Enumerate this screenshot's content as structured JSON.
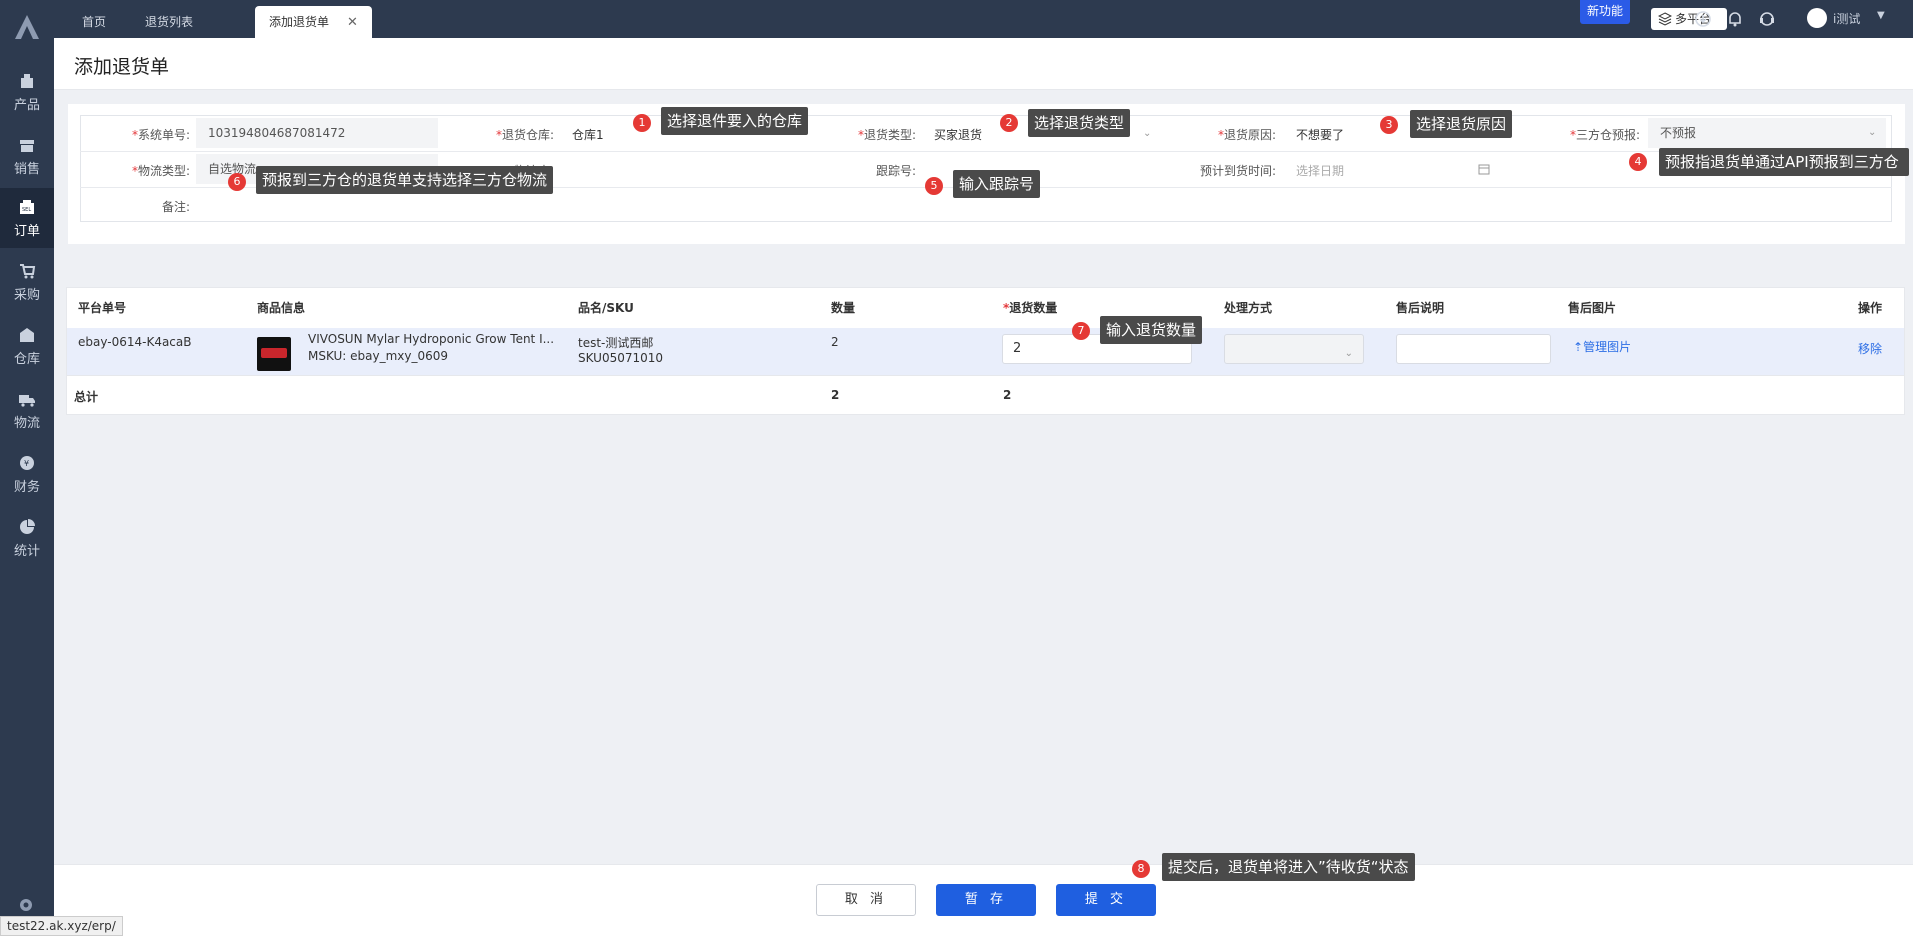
{
  "sidebar": {
    "items": [
      {
        "label": "产品",
        "icon": "box-icon"
      },
      {
        "label": "销售",
        "icon": "shop-icon"
      },
      {
        "label": "订单",
        "icon": "order-icon"
      },
      {
        "label": "采购",
        "icon": "cart-icon"
      },
      {
        "label": "仓库",
        "icon": "warehouse-icon"
      },
      {
        "label": "物流",
        "icon": "truck-icon"
      },
      {
        "label": "财务",
        "icon": "finance-icon"
      },
      {
        "label": "统计",
        "icon": "pie-icon"
      }
    ],
    "active_index": 2
  },
  "tabs": [
    {
      "label": "首页"
    },
    {
      "label": "退货列表"
    },
    {
      "label": "添加退货单"
    }
  ],
  "topbar": {
    "new_feature": "新功能",
    "multi_platform": "多平台",
    "user_name": "i测试"
  },
  "page": {
    "title": "添加退货单"
  },
  "form": {
    "system_no_label": "系统单号:",
    "system_no": "103194804687081472",
    "return_warehouse_label": "退货仓库:",
    "return_warehouse": "仓库1",
    "return_type_label": "退货类型:",
    "return_type": "买家退货",
    "return_reason_label": "退货原因:",
    "return_reason": "不想要了",
    "third_party_label": "三方仓预报:",
    "third_party": "不预报",
    "logistics_type_label": "物流类型:",
    "logistics_type": "自选物流",
    "logistics_carrier_label": "物流商:",
    "tracking_label": "跟踪号:",
    "eta_label": "预计到货时间:",
    "eta_placeholder": "选择日期",
    "remark_label": "备注:"
  },
  "table": {
    "headers": {
      "platform_no": "平台单号",
      "product_info": "商品信息",
      "name_sku": "品名/SKU",
      "qty": "数量",
      "return_qty": "退货数量",
      "handling": "处理方式",
      "after_sale_note": "售后说明",
      "after_sale_img": "售后图片",
      "action": "操作"
    },
    "row": {
      "platform_no": "ebay-0614-K4acaB",
      "product_title": "VIVOSUN Mylar Hydroponic Grow Tent I...",
      "msku": "MSKU: ebay_mxy_0609",
      "name": "test-测试西邮",
      "sku": "SKU05071010",
      "qty": "2",
      "return_qty": "2",
      "manage_images": "管理图片",
      "remove": "移除"
    },
    "total": {
      "label": "总计",
      "qty": "2",
      "return_qty": "2"
    }
  },
  "buttons": {
    "cancel": "取 消",
    "save": "暂 存",
    "submit": "提 交"
  },
  "status_url": "test22.ak.xyz/erp/",
  "callouts": [
    {
      "n": "1",
      "text": "选择退件要入的仓库"
    },
    {
      "n": "2",
      "text": "选择退货类型"
    },
    {
      "n": "3",
      "text": "选择退货原因"
    },
    {
      "n": "4",
      "text": "预报指退货单通过API预报到三方仓"
    },
    {
      "n": "5",
      "text": "输入跟踪号"
    },
    {
      "n": "6",
      "text": "预报到三方仓的退货单支持选择三方仓物流"
    },
    {
      "n": "7",
      "text": "输入退货数量"
    },
    {
      "n": "8",
      "text": "提交后，退货单将进入”待收货“状态"
    }
  ],
  "colors": {
    "sidebar": "#2d3a4f",
    "primary": "#1f5fe0",
    "callout_badge": "#e53935",
    "callout_bg": "#4a4a4a"
  }
}
